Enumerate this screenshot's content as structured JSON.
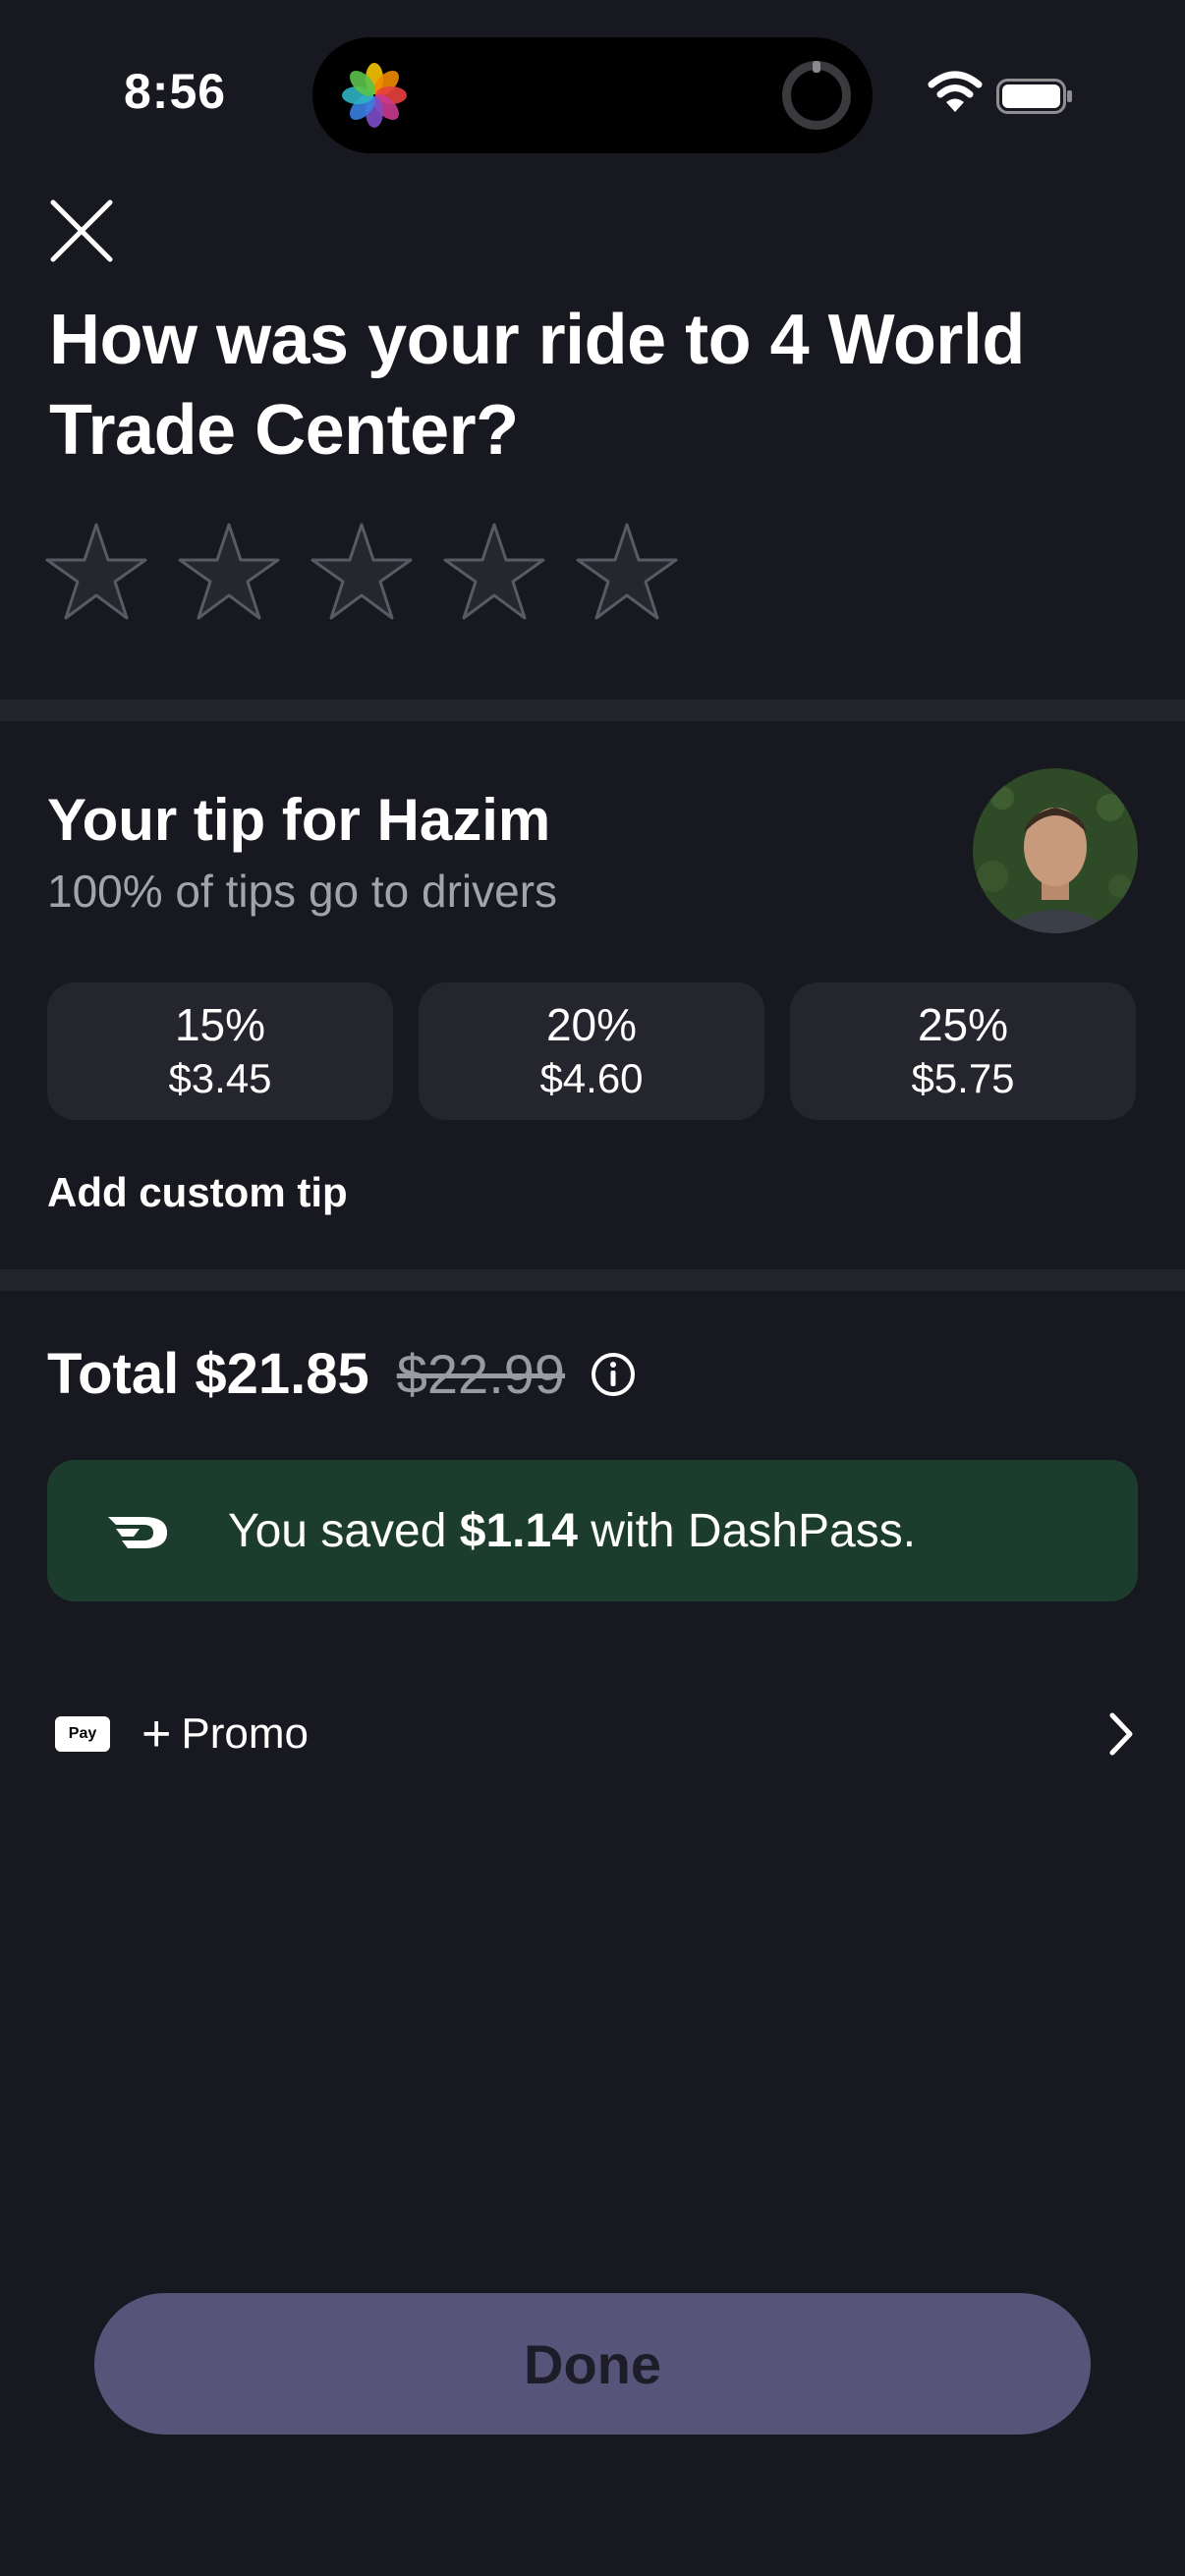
{
  "status_bar": {
    "time": "8:56"
  },
  "rating": {
    "title": "How was your ride to 4 World Trade Center?",
    "stars": 0,
    "max_stars": 5
  },
  "tip": {
    "title": "Your tip for Hazim",
    "subtitle": "100% of tips go to drivers",
    "options": [
      {
        "percent": "15%",
        "amount": "$3.45"
      },
      {
        "percent": "20%",
        "amount": "$4.60"
      },
      {
        "percent": "25%",
        "amount": "$5.75"
      }
    ],
    "custom_label": "Add custom tip"
  },
  "total": {
    "label": "Total $21.85",
    "original": "$22.99"
  },
  "savings": {
    "prefix": "You saved",
    "amount": "$1.14",
    "suffix": "with DashPass."
  },
  "payment": {
    "method_icon": "apple-pay-icon",
    "method_label": "Pay",
    "promo_label": "Promo"
  },
  "done_label": "Done",
  "colors": {
    "background": "#181820",
    "banner": "#1c3d2e",
    "done_button": "#575479"
  }
}
